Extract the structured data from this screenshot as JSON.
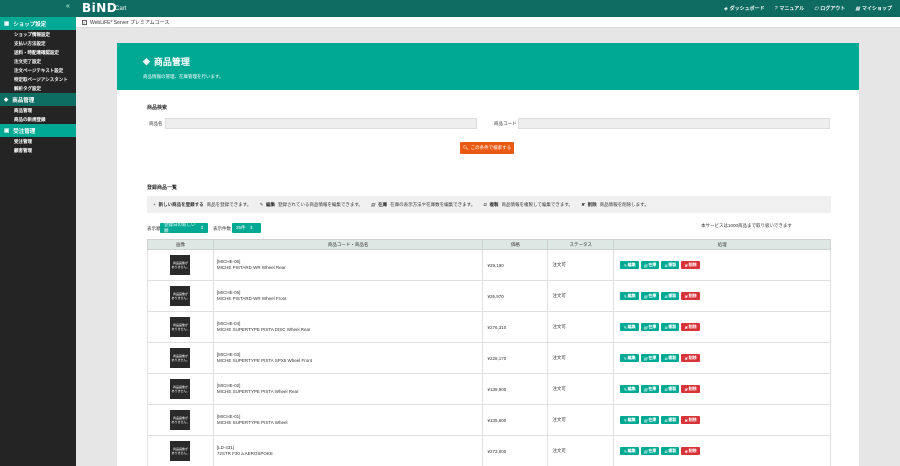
{
  "header": {
    "collapse": "«",
    "logo": "BiND",
    "logo_sub": "Cart",
    "nav": [
      {
        "icon": "dashboard-icon",
        "glyph": "◈",
        "label": "ダッシュボード"
      },
      {
        "icon": "help-icon",
        "glyph": "?",
        "label": "マニュアル"
      },
      {
        "icon": "logout-icon",
        "glyph": "⏻",
        "label": "ログアウト"
      },
      {
        "icon": "shop-icon",
        "glyph": "▦",
        "label": "マイショップ"
      }
    ]
  },
  "subbar": {
    "check": "✓",
    "text": "WebLiFE* Server プレミアムコース"
  },
  "sidebar": {
    "groups": [
      {
        "title": "ショップ設定",
        "icon": "store-icon",
        "glyph": "▦",
        "items": [
          "ショップ情報設定",
          "支払い方法設定",
          "送料・時配達確認設定",
          "注文完了設定",
          "注文ページテキスト設定",
          "特定取ページアシスタント",
          "解析タグ設定"
        ]
      },
      {
        "title": "商品管理",
        "icon": "tag-icon",
        "glyph": "◆",
        "items": [
          "商品管理",
          "商品の新規登録"
        ]
      },
      {
        "title": "受注管理",
        "icon": "cart-icon",
        "glyph": "▣",
        "items": [
          "受注管理",
          "顧客管理"
        ]
      }
    ]
  },
  "banner": {
    "glyph": "◈",
    "title": "商品管理",
    "subtitle": "商品情報の管理、在庫管理を行います。"
  },
  "search": {
    "title": "商品検索",
    "name_label": "商品名",
    "code_label": "商品コード",
    "button": "この条件で検索する",
    "button_glyph": "🔍︎"
  },
  "list": {
    "title": "登録商品一覧",
    "hints": [
      {
        "glyph": "+",
        "bold": "新しい商品を登録する",
        "text": "商品を登録できます。"
      },
      {
        "glyph": "✎",
        "bold": "編集",
        "text": "登録されている商品情報を編集できます。"
      },
      {
        "glyph": "▤",
        "bold": "在庫",
        "text": "在庫の表示方法や在庫数を編集できます。"
      },
      {
        "glyph": "⧉",
        "bold": "複製",
        "text": "商品情報を複製して編集できます。"
      },
      {
        "glyph": "✖",
        "bold": "削除",
        "text": "商品情報を削除します。"
      }
    ],
    "order_label": "表示順",
    "order_value": "登録日の新しい順",
    "count_label": "表示件数",
    "count_value": "25件",
    "note": "本サービスは1000商品まで取り扱いできます",
    "columns": [
      "画像",
      "商品コード・商品名",
      "価格",
      "ステータス",
      "処理"
    ],
    "thumb_text": "商品画像が\nありません。",
    "actions": {
      "edit": "編集",
      "stock": "在庫",
      "copy": "複製",
      "delete": "削除"
    },
    "rows": [
      {
        "code": "[MICHE-06]",
        "name": "MICHE PISTARD WR Wheel Rear",
        "price": "¥29,190",
        "status": "注文可"
      },
      {
        "code": "[MICHE-05]",
        "name": "MICHE PISTARD WR Wheel Front",
        "price": "¥26,970",
        "status": "注文可"
      },
      {
        "code": "[MICHE-04]",
        "name": "MICHE SUPERTYPE PISTA DISC Wheel Rear",
        "price": "¥276,310",
        "status": "注文可"
      },
      {
        "code": "[MICHE-03]",
        "name": "MICHE SUPERTYPE PISTA SPX5 Wheel Front",
        "price": "¥228,170",
        "status": "注文可"
      },
      {
        "code": "[MICHE-02]",
        "name": "MICHE SUPERTYPE PISTA Wheel Rear",
        "price": "¥139,900",
        "status": "注文可"
      },
      {
        "code": "[MICHE-01]",
        "name": "MICHE SUPERTYPE PISTA Wheel",
        "price": "¥135,600",
        "status": "注文可"
      },
      {
        "code": "[LD-431]",
        "name": "72STR F30 a AEROSPOKE",
        "price": "¥273,000",
        "status": "注文可"
      }
    ]
  }
}
